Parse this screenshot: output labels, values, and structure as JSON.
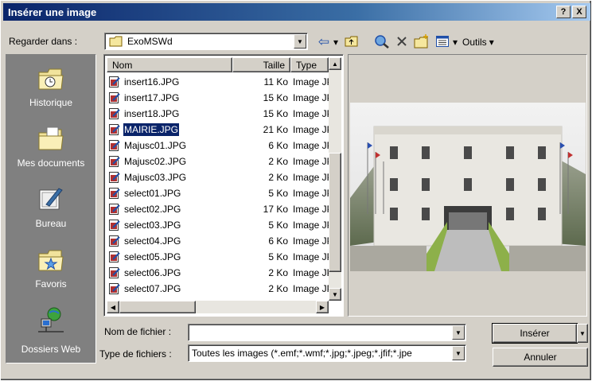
{
  "window": {
    "title": "Insérer une image",
    "help_label": "?",
    "close_label": "X"
  },
  "toolbar": {
    "look_in_label": "Regarder dans :",
    "look_in_value": "ExoMSWd",
    "back_arrow": "⇦",
    "tools_label": "Outils",
    "dropdown_arrow": "▾"
  },
  "places": [
    {
      "label": "Historique",
      "icon": "history-folder-icon"
    },
    {
      "label": "Mes documents",
      "icon": "my-documents-folder-icon"
    },
    {
      "label": "Bureau",
      "icon": "desktop-icon"
    },
    {
      "label": "Favoris",
      "icon": "favorites-folder-icon"
    },
    {
      "label": "Dossiers Web",
      "icon": "web-folders-icon"
    }
  ],
  "file_list": {
    "columns": [
      "Nom",
      "Taille",
      "Type"
    ],
    "rows": [
      {
        "name": "insert16.JPG",
        "size": "11 Ko",
        "type": "Image JPEG"
      },
      {
        "name": "insert17.JPG",
        "size": "15 Ko",
        "type": "Image JPEG"
      },
      {
        "name": "insert18.JPG",
        "size": "15 Ko",
        "type": "Image JPEG"
      },
      {
        "name": "MAIRIE.JPG",
        "size": "21 Ko",
        "type": "Image JPEG",
        "selected": true
      },
      {
        "name": "Majusc01.JPG",
        "size": "6 Ko",
        "type": "Image JPEG"
      },
      {
        "name": "Majusc02.JPG",
        "size": "2 Ko",
        "type": "Image JPEG"
      },
      {
        "name": "Majusc03.JPG",
        "size": "2 Ko",
        "type": "Image JPEG"
      },
      {
        "name": "select01.JPG",
        "size": "5 Ko",
        "type": "Image JPEG"
      },
      {
        "name": "select02.JPG",
        "size": "17 Ko",
        "type": "Image JPEG"
      },
      {
        "name": "select03.JPG",
        "size": "5 Ko",
        "type": "Image JPEG"
      },
      {
        "name": "select04.JPG",
        "size": "6 Ko",
        "type": "Image JPEG"
      },
      {
        "name": "select05.JPG",
        "size": "5 Ko",
        "type": "Image JPEG"
      },
      {
        "name": "select06.JPG",
        "size": "2 Ko",
        "type": "Image JPEG"
      },
      {
        "name": "select07.JPG",
        "size": "2 Ko",
        "type": "Image JPEG"
      }
    ]
  },
  "form": {
    "filename_label": "Nom de fichier :",
    "filename_value": "",
    "filetype_label": "Type de fichiers :",
    "filetype_value": "Toutes les images (*.emf;*.wmf;*.jpg;*.jpeg;*.jfif;*.jpe"
  },
  "buttons": {
    "insert": "Insérer",
    "cancel": "Annuler"
  },
  "colors": {
    "title_bar": "#0a246a",
    "face": "#d4d0c8",
    "selection": "#0a246a"
  }
}
